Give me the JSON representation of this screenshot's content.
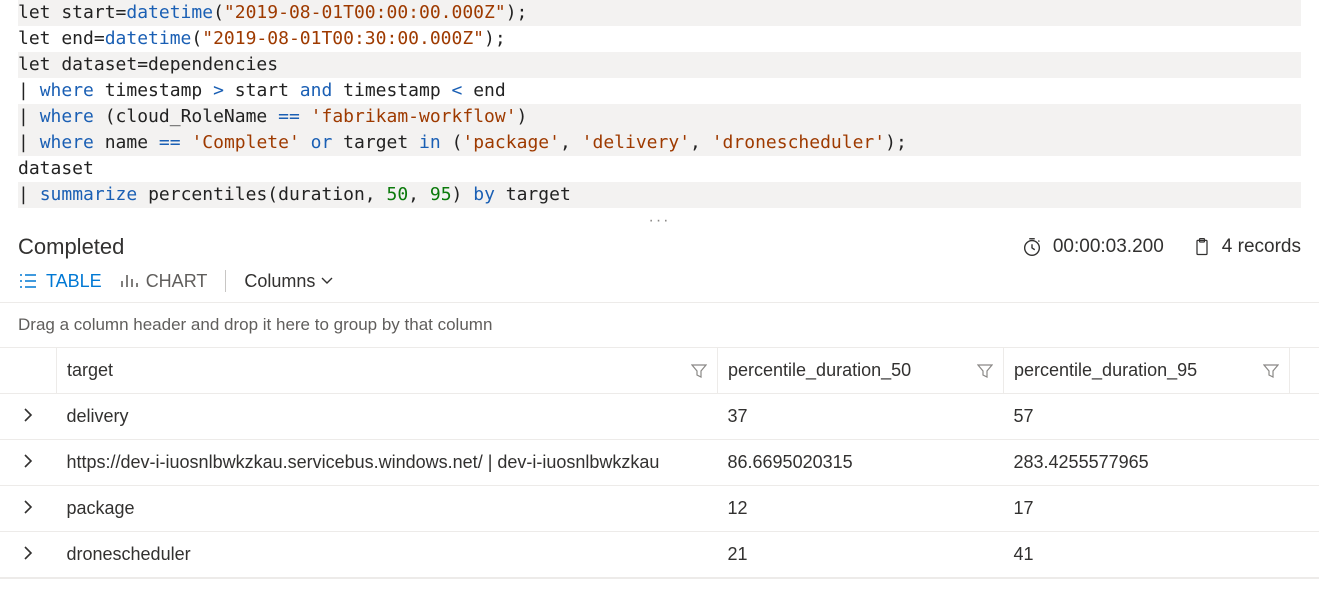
{
  "code_lines": [
    {
      "hl": true,
      "frags": [
        [
          "",
          "let start="
        ],
        [
          "fn",
          "datetime"
        ],
        [
          "",
          "("
        ],
        [
          "str",
          "\"2019-08-01T00:00:00.000Z\""
        ],
        [
          "",
          ");"
        ]
      ]
    },
    {
      "hl": false,
      "frags": [
        [
          "",
          "let end="
        ],
        [
          "fn",
          "datetime"
        ],
        [
          "",
          "("
        ],
        [
          "str",
          "\"2019-08-01T00:30:00.000Z\""
        ],
        [
          "",
          ");"
        ]
      ]
    },
    {
      "hl": true,
      "frags": [
        [
          "",
          "let dataset=dependencies"
        ]
      ]
    },
    {
      "hl": false,
      "frags": [
        [
          "",
          "| "
        ],
        [
          "kw",
          "where"
        ],
        [
          "",
          " timestamp "
        ],
        [
          "op",
          ">"
        ],
        [
          "",
          " start "
        ],
        [
          "kw",
          "and"
        ],
        [
          "",
          " timestamp "
        ],
        [
          "op",
          "<"
        ],
        [
          "",
          " end"
        ]
      ]
    },
    {
      "hl": true,
      "frags": [
        [
          "",
          "| "
        ],
        [
          "kw",
          "where"
        ],
        [
          "",
          " (cloud_RoleName "
        ],
        [
          "op",
          "=="
        ],
        [
          "",
          " "
        ],
        [
          "str",
          "'fabrikam-workflow'"
        ],
        [
          "",
          ")"
        ]
      ]
    },
    {
      "hl": true,
      "frags": [
        [
          "",
          "| "
        ],
        [
          "kw",
          "where"
        ],
        [
          "",
          " name "
        ],
        [
          "op",
          "=="
        ],
        [
          "",
          " "
        ],
        [
          "str",
          "'Complete'"
        ],
        [
          "",
          " "
        ],
        [
          "kw",
          "or"
        ],
        [
          "",
          " target "
        ],
        [
          "kw",
          "in"
        ],
        [
          "",
          " ("
        ],
        [
          "str",
          "'package'"
        ],
        [
          "",
          ", "
        ],
        [
          "str",
          "'delivery'"
        ],
        [
          "",
          ", "
        ],
        [
          "str",
          "'dronescheduler'"
        ],
        [
          "",
          ");"
        ]
      ]
    },
    {
      "hl": false,
      "frags": [
        [
          "",
          "dataset"
        ]
      ]
    },
    {
      "hl": true,
      "frags": [
        [
          "",
          "| "
        ],
        [
          "kw",
          "summarize"
        ],
        [
          "",
          " percentiles(duration, "
        ],
        [
          "num",
          "50"
        ],
        [
          "",
          ", "
        ],
        [
          "num",
          "95"
        ],
        [
          "",
          ") "
        ],
        [
          "kw",
          "by"
        ],
        [
          "",
          " target"
        ]
      ]
    }
  ],
  "status": {
    "label": "Completed",
    "duration": "00:00:03.200",
    "record_count": "4 records"
  },
  "toolbar": {
    "table_label": "TABLE",
    "chart_label": "CHART",
    "columns_label": "Columns"
  },
  "groupby_hint": "Drag a column header and drop it here to group by that column",
  "columns": [
    "target",
    "percentile_duration_50",
    "percentile_duration_95"
  ],
  "rows": [
    {
      "target": "delivery",
      "p50": "37",
      "p95": "57"
    },
    {
      "target": "https://dev-i-iuosnlbwkzkau.servicebus.windows.net/ | dev-i-iuosnlbwkzkau",
      "p50": "86.6695020315",
      "p95": "283.4255577965"
    },
    {
      "target": "package",
      "p50": "12",
      "p95": "17"
    },
    {
      "target": "dronescheduler",
      "p50": "21",
      "p95": "41"
    }
  ]
}
